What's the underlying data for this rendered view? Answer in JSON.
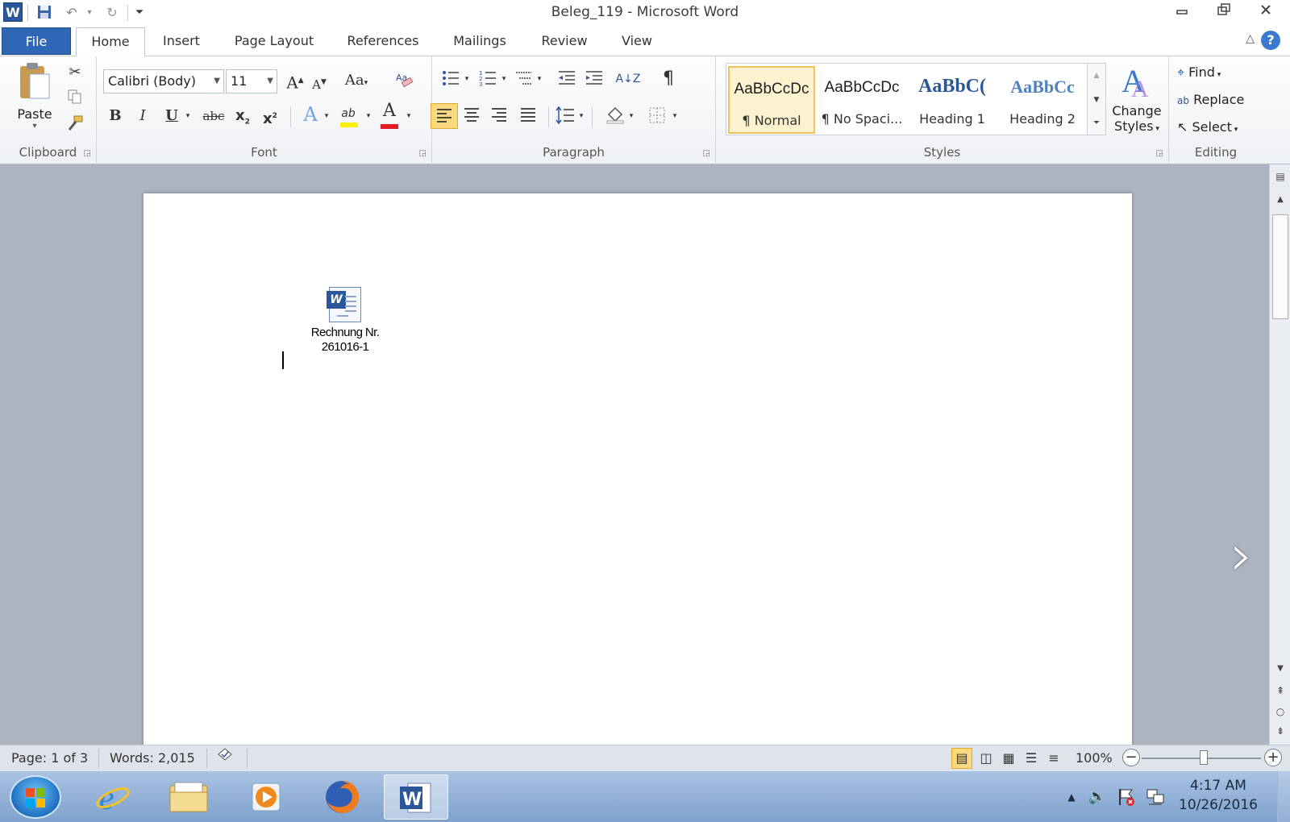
{
  "window": {
    "title": "Beleg_119  -  Microsoft Word",
    "app_icon_letter": "W"
  },
  "quick_access": {
    "save_icon": "save-icon",
    "undo_icon": "undo-icon",
    "redo_icon": "redo-icon",
    "customize_icon": "customize-qat-icon"
  },
  "tabs": {
    "file": "File",
    "items": [
      "Home",
      "Insert",
      "Page Layout",
      "References",
      "Mailings",
      "Review",
      "View"
    ],
    "active": "Home"
  },
  "clipboard": {
    "paste_label": "Paste",
    "group_label": "Clipboard"
  },
  "font": {
    "font_name": "Calibri (Body)",
    "font_size": "11",
    "change_case": "Aa",
    "bold": "B",
    "italic": "I",
    "underline": "U",
    "strikethrough": "abc",
    "subscript": "x",
    "superscript": "x",
    "highlight_label": "ab",
    "font_color_label": "A",
    "grow_font": "A",
    "shrink_font": "A",
    "group_label": "Font",
    "highlight_color": "#f5f100",
    "font_color": "#e31b23"
  },
  "paragraph": {
    "sort_label": "A↓Z",
    "pilcrow": "¶",
    "group_label": "Paragraph"
  },
  "styles": {
    "items": [
      {
        "sample": "AaBbCcDc",
        "name": "¶ Normal",
        "selected": true
      },
      {
        "sample": "AaBbCcDc",
        "name": "¶ No Spaci...",
        "selected": false
      },
      {
        "sample": "AaBbC(",
        "name": "Heading 1",
        "selected": false
      },
      {
        "sample": "AaBbCc",
        "name": "Heading 2",
        "selected": false
      }
    ],
    "change_styles_label": "Change Styles",
    "change_styles_line1": "Change",
    "change_styles_line2": "Styles",
    "group_label": "Styles"
  },
  "editing": {
    "find": "Find",
    "replace": "Replace",
    "select": "Select",
    "group_label": "Editing"
  },
  "document": {
    "embedded_object_line1": "Rechnung Nr.",
    "embedded_object_line2": "261016-1"
  },
  "statusbar": {
    "page": "Page: 1 of 3",
    "words": "Words: 2,015",
    "zoom": "100%",
    "zoom_level_percent": 100
  },
  "taskbar": {
    "apps": [
      "internet-explorer",
      "file-explorer",
      "media-player",
      "firefox",
      "microsoft-word"
    ],
    "active_app": "microsoft-word",
    "time": "4:17 AM",
    "date": "10/26/2016"
  },
  "colors": {
    "file_tab": "#2d67b5",
    "accent": "#2b579a",
    "selected_style": "#fdf2cf",
    "doc_background": "#abb4c0"
  }
}
